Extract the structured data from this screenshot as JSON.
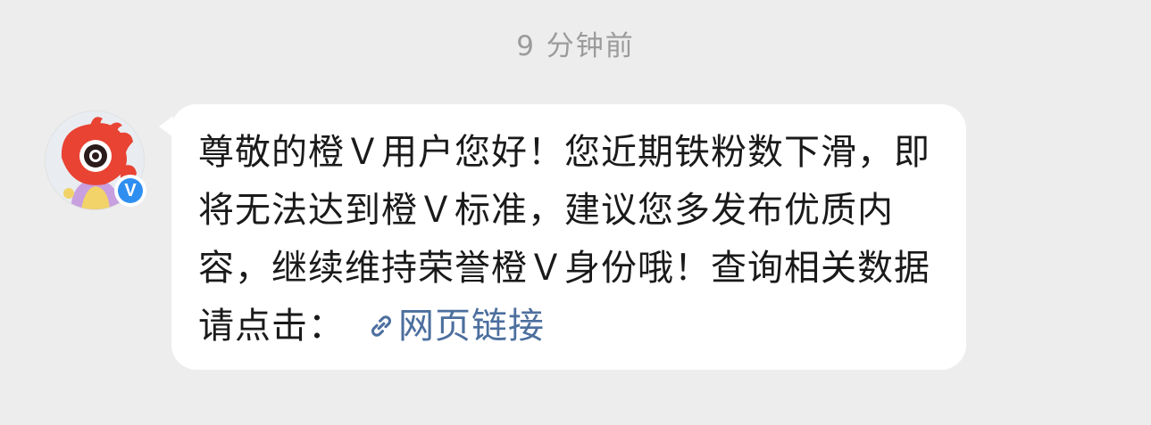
{
  "timestamp": "9 分钟前",
  "sender": {
    "avatar_icon": "mascot-avatar-icon",
    "verified_badge": "V",
    "badge_color": "#2f8ff0"
  },
  "message": {
    "text": "尊敬的橙Ｖ用户您好！您近期铁粉数下滑，即将无法达到橙Ｖ标准，建议您多发布优质内容，继续维持荣誉橙Ｖ身份哦！查询相关数据请点击：",
    "link_label": "网页链接",
    "link_icon": "link-icon",
    "link_color": "#4c6f9e"
  }
}
